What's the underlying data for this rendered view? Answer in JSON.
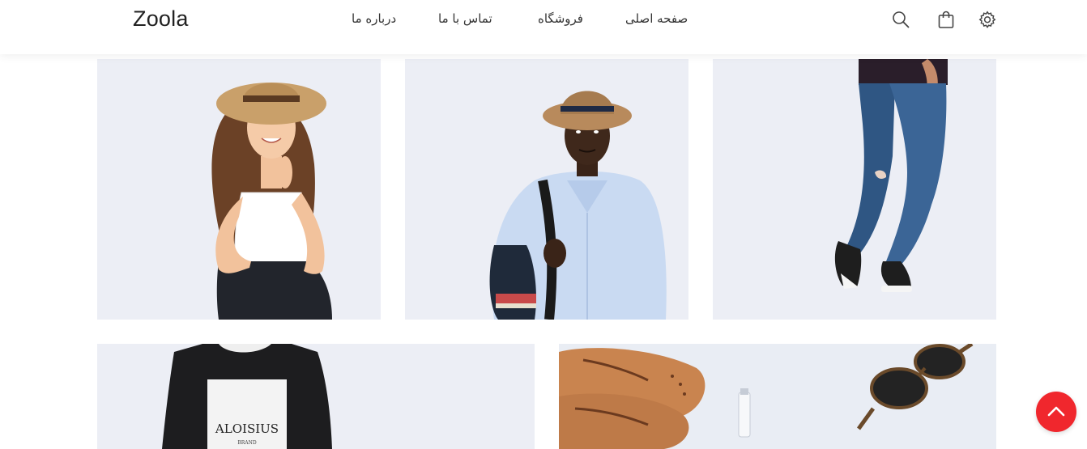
{
  "brand": {
    "logo_text": "Zoola"
  },
  "nav": {
    "items": [
      {
        "label": "صفحه اصلی"
      },
      {
        "label": "فروشگاه"
      },
      {
        "label": "تماس با ما"
      },
      {
        "label": "درباره ما"
      }
    ]
  },
  "header_icons": [
    "search-icon",
    "shopping-bag-icon",
    "gear-icon"
  ],
  "gallery": {
    "row1": [
      "woman-in-straw-hat",
      "man-in-fedora-with-backpack",
      "man-in-jeans-and-sneakers"
    ],
    "row2": [
      "model-in-black-sweatshirt",
      "brown-shoes-and-sunglasses"
    ],
    "sweatshirt_print": "ALOISIUS BRAND"
  },
  "scroll_top": {
    "icon": "chevron-up-icon"
  },
  "colors": {
    "accent": "#f0272d",
    "tile_bg": "#eceef5",
    "header_bg": "#ffffff"
  }
}
